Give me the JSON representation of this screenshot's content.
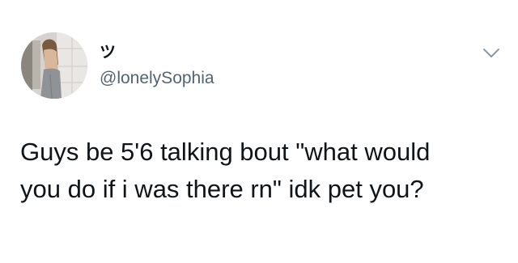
{
  "tweet": {
    "display_name": "ツ",
    "handle": "@lonelySophia",
    "text": "Guys be 5'6 talking bout \"what would\nyou do if i was there rn\" idk pet you?",
    "menu_icon": "chevron-down-icon",
    "avatar_icon": "profile-photo"
  }
}
